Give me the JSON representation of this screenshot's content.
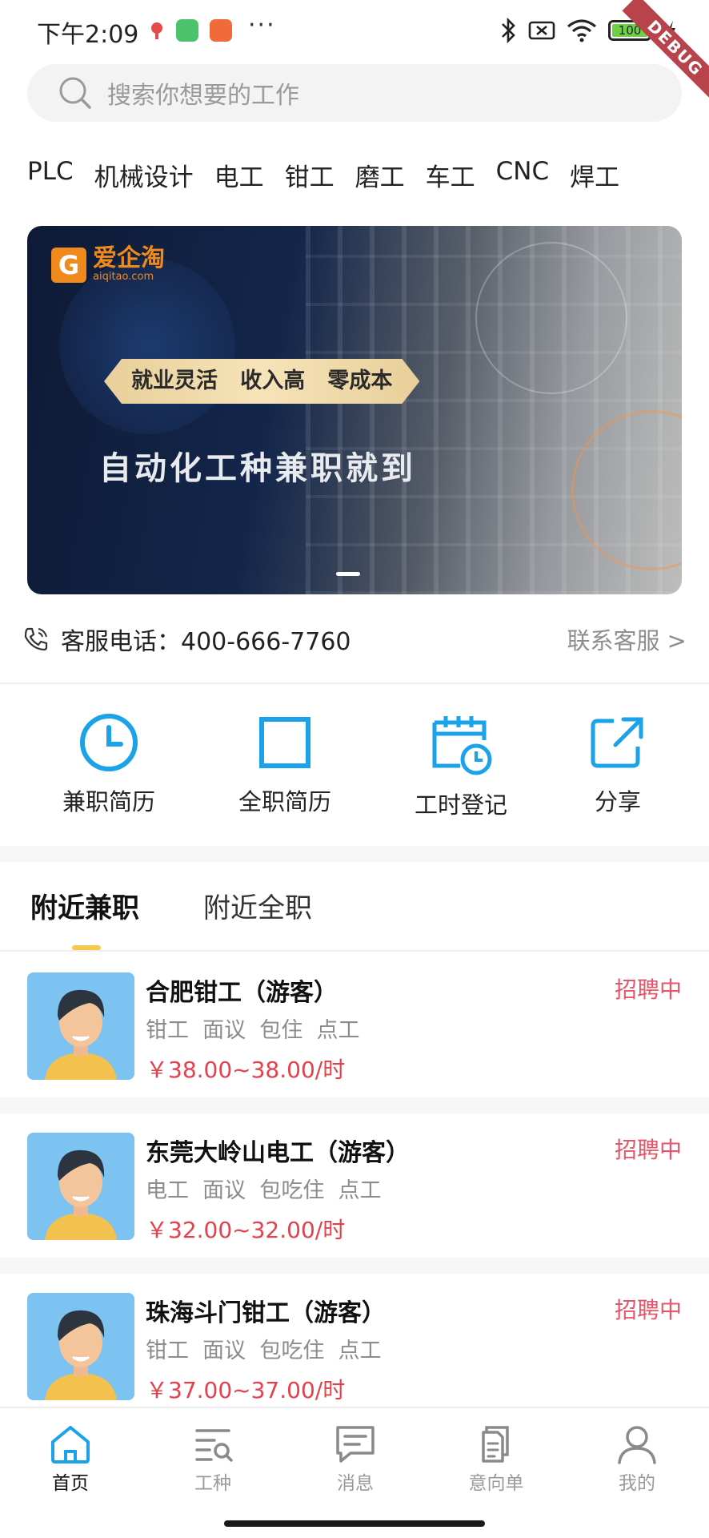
{
  "status_bar": {
    "time": "下午2:09",
    "battery": "100",
    "debug_label": "DEBUG"
  },
  "search": {
    "placeholder": "搜索你想要的工作"
  },
  "categories": [
    "PLC",
    "机械设计",
    "电工",
    "钳工",
    "磨工",
    "车工",
    "CNC",
    "焊工"
  ],
  "banner": {
    "logo_text": "爱企淘",
    "logo_sub": "aiqitao.com",
    "tagline": "就业灵活   收入高   零成本",
    "headline": "自动化工种兼职就到"
  },
  "hotline": {
    "label": "客服电话：400-666-7760",
    "contact_link": "联系客服 >"
  },
  "quick_actions": [
    {
      "label": "兼职简历",
      "icon": "clock-icon"
    },
    {
      "label": "全职简历",
      "icon": "square-icon"
    },
    {
      "label": "工时登记",
      "icon": "calendar-clock-icon"
    },
    {
      "label": "分享",
      "icon": "share-icon"
    }
  ],
  "tabs": [
    {
      "label": "附近兼职",
      "active": true
    },
    {
      "label": "附近全职",
      "active": false
    }
  ],
  "jobs": [
    {
      "title": "合肥钳工（游客）",
      "status": "招聘中",
      "tags": "钳工  面议  包住  点工",
      "salary": "￥38.00~38.00/时"
    },
    {
      "title": "东莞大岭山电工（游客）",
      "status": "招聘中",
      "tags": "电工  面议  包吃住  点工",
      "salary": "￥32.00~32.00/时"
    },
    {
      "title": "珠海斗门钳工（游客）",
      "status": "招聘中",
      "tags": "钳工  面议  包吃住  点工",
      "salary": "￥37.00~37.00/时"
    }
  ],
  "bottom_nav": [
    {
      "label": "首页",
      "icon": "home-icon",
      "active": true
    },
    {
      "label": "工种",
      "icon": "list-search-icon",
      "active": false
    },
    {
      "label": "消息",
      "icon": "message-icon",
      "active": false
    },
    {
      "label": "意向单",
      "icon": "document-icon",
      "active": false
    },
    {
      "label": "我的",
      "icon": "user-icon",
      "active": false
    }
  ],
  "colors": {
    "accent_blue": "#1aa3e8",
    "recruiting_pink": "#e5566a",
    "salary_red": "#e5414d",
    "tab_underline": "#f2c94c"
  }
}
